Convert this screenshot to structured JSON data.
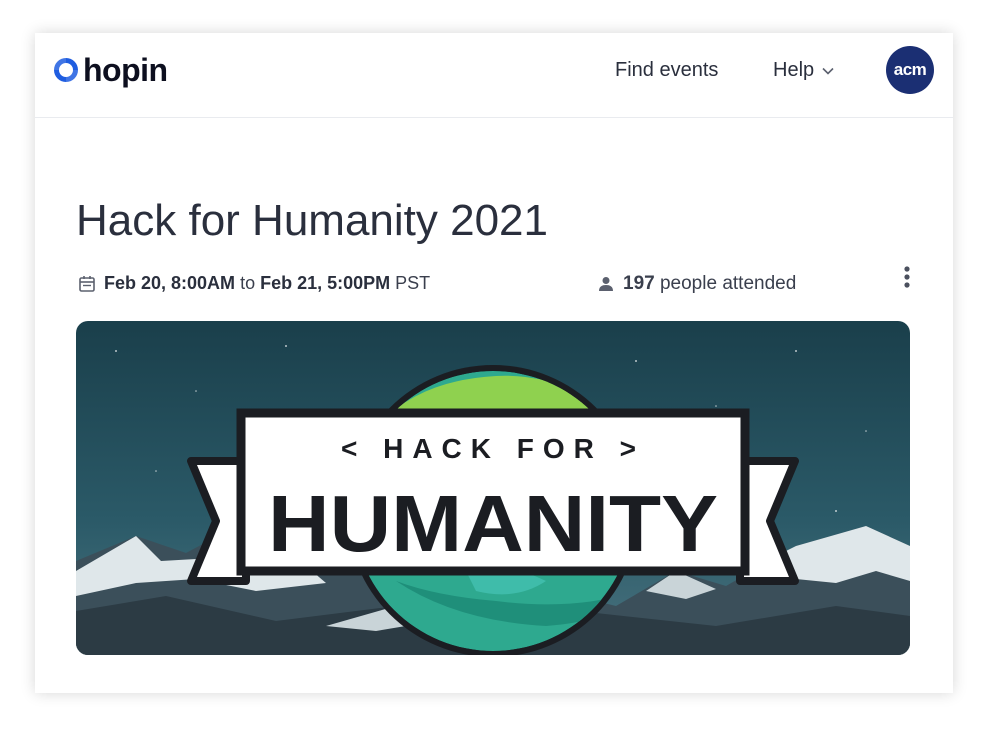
{
  "brand": {
    "name": "hopin",
    "color": "#1f5de0"
  },
  "nav": {
    "find_events": "Find events",
    "help": "Help",
    "avatar_initials": "acm"
  },
  "event": {
    "title": "Hack for Humanity 2021",
    "start": "Feb 20, 8:00AM",
    "to": "to",
    "end": "Feb 21, 5:00PM",
    "timezone": "PST",
    "attendee_count": "197",
    "attendee_label": "people attended"
  },
  "banner": {
    "line1": "< HACK FOR >",
    "line2": "HUMANITY"
  },
  "colors": {
    "avatar_bg": "#1b2f73",
    "sky_top": "#1a3f4b",
    "globe_ocean": "#2ea98f",
    "globe_land": "#8fd14f"
  }
}
